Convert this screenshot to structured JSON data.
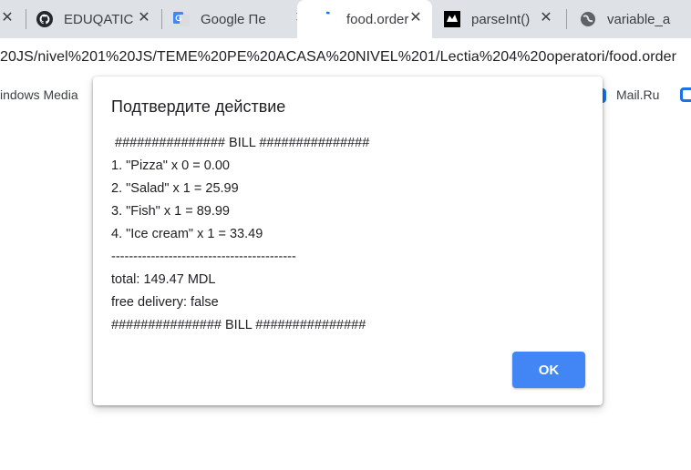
{
  "browser": {
    "tabs": [
      {
        "title": "",
        "icon": "tab-close-icon"
      },
      {
        "title": "EDUQATIC",
        "icon": "github-icon"
      },
      {
        "title": "Google Пе",
        "icon": "google-translate-icon"
      },
      {
        "title": "food.order",
        "icon": "loading-spinner-icon",
        "active": true
      },
      {
        "title": "parseInt()",
        "icon": "mdn-icon"
      },
      {
        "title": "variable_a",
        "icon": "globe-icon"
      }
    ],
    "address_bar": {
      "url": "20JS/nivel%201%20JS/TEME%20PE%20ACASA%20NIVEL%201/Lectia%204%20operatori/food.order"
    },
    "bookmarks": [
      {
        "label": "indows Media"
      },
      {
        "label": "Mail.Ru"
      }
    ],
    "close_glyph": "✕"
  },
  "dialog": {
    "title": "Подтвердите действие",
    "message_lines": [
      " ############### BILL ###############",
      "1. \"Pizza\" x 0 = 0.00",
      "2. \"Salad\" x 1 = 25.99",
      "3. \"Fish\" x 1 = 89.99",
      "4. \"Ice cream\" x 1 = 33.49",
      "------------------------------------------",
      "total: 149.47 MDL",
      "free delivery: false",
      "############### BILL ###############"
    ],
    "ok_label": "OK"
  },
  "colors": {
    "tab_strip": "#dee1e6",
    "ok_button": "#4285f4"
  }
}
